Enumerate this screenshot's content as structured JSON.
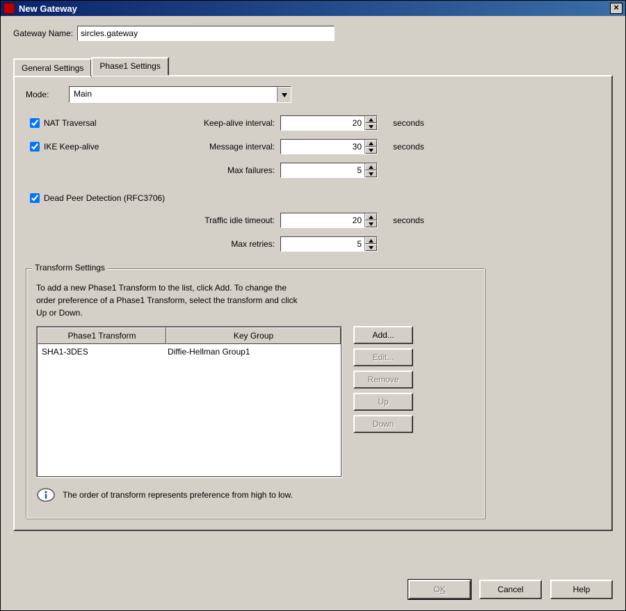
{
  "window": {
    "title": "New Gateway"
  },
  "gatewayName": {
    "label": "Gateway Name:",
    "value": "sircles.gateway"
  },
  "tabs": {
    "general": "General Settings",
    "phase1": "Phase1 Settings"
  },
  "mode": {
    "label": "Mode:",
    "value": "Main"
  },
  "nat": {
    "label": "NAT Traversal",
    "checked": true
  },
  "ike": {
    "label": "IKE Keep-alive",
    "checked": true
  },
  "keepAlive": {
    "label": "Keep-alive interval:",
    "value": "20",
    "unit": "seconds"
  },
  "msgInterval": {
    "label": "Message interval:",
    "value": "30",
    "unit": "seconds"
  },
  "maxFailures": {
    "label": "Max failures:",
    "value": "5"
  },
  "dpd": {
    "label": "Dead Peer Detection (RFC3706)",
    "checked": true
  },
  "trafficIdle": {
    "label": "Traffic idle timeout:",
    "value": "20",
    "unit": "seconds"
  },
  "maxRetries": {
    "label": "Max retries:",
    "value": "5"
  },
  "transform": {
    "title": "Transform Settings",
    "desc1": "To add a new Phase1 Transform to the list, click Add. To change the",
    "desc2": "order preference of a Phase1 Transform, select the transform and click",
    "desc3": "Up or Down.",
    "col1": "Phase1 Transform",
    "col2": "Key Group",
    "rows": [
      {
        "transform": "SHA1-3DES",
        "keygroup": "Diffie-Hellman Group1"
      }
    ],
    "info": "The order of transform represents preference from high to low."
  },
  "buttons": {
    "add": "Add...",
    "edit": "Edit...",
    "remove": "Remove",
    "up": "Up",
    "down": "Down",
    "ok_pre": "O",
    "ok_u": "K",
    "cancel": "Cancel",
    "help": "Help"
  }
}
